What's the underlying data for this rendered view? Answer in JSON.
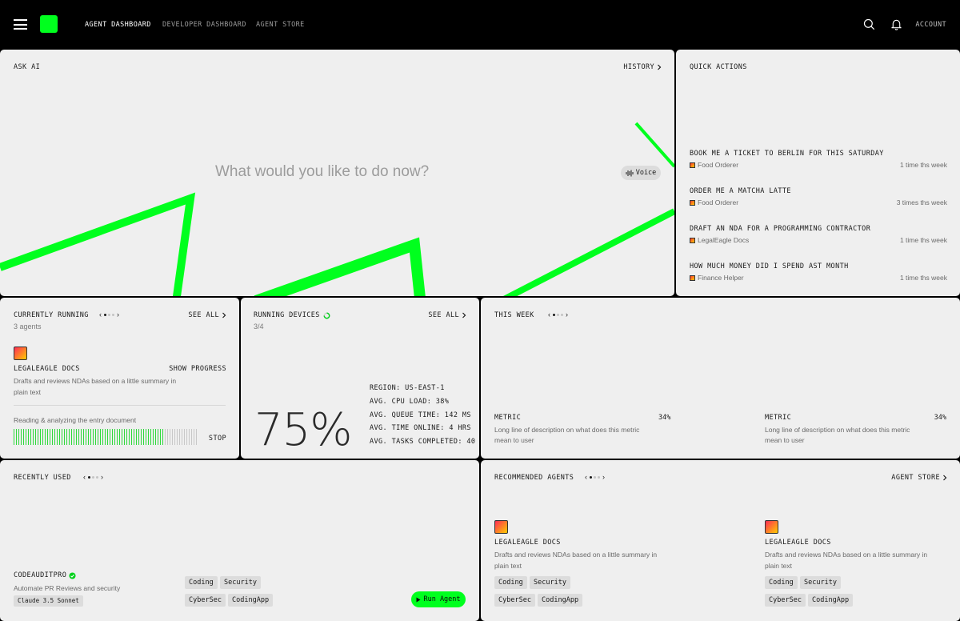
{
  "nav": {
    "items": [
      "AGENT DASHBOARD",
      "DEVELOPER DASHBOARD",
      "AGENT STORE"
    ],
    "account": "ACCOUNT"
  },
  "ask": {
    "title": "ASK AI",
    "history": "HISTORY",
    "placeholder": "What would you like to do now?",
    "voice": "Voice"
  },
  "quick_actions": {
    "title": "QUICK ACTIONS",
    "items": [
      {
        "title": "BOOK ME A TICKET TO BERLIN FOR THIS SATURDAY",
        "agent": "Food Orderer",
        "freq": "1 time ths week"
      },
      {
        "title": "ORDER ME A MATCHA LATTE",
        "agent": "Food Orderer",
        "freq": "3 times ths week"
      },
      {
        "title": "DRAFT AN NDA FOR A PROGRAMMING CONTRACTOR",
        "agent": "LegalEagle Docs",
        "freq": "1 time ths week"
      },
      {
        "title": "HOW MUCH MONEY DID I SPEND AST MONTH",
        "agent": "Finance Helper",
        "freq": "1 time ths week"
      }
    ]
  },
  "running": {
    "title": "CURRENTLY RUNNING",
    "count": "3 agents",
    "see_all": "SEE ALL",
    "agent_name": "LEGALEAGLE DOCS",
    "show_progress": "SHOW PROGRESS",
    "desc": "Drafts and reviews NDAs based on a little summary in plain text",
    "status": "Reading & analyzing the entry document",
    "stop": "STOP",
    "progress": 0.82
  },
  "devices": {
    "title": "RUNNING DEVICES",
    "count": "3/4",
    "see_all": "SEE ALL",
    "percent": "75%",
    "stats": [
      "REGION: US-EAST-1",
      "AVG. CPU LOAD: 38%",
      "AVG. QUEUE TIME: 142 MS",
      "AVG. TIME ONLINE: 4 HRS",
      "AVG. TASKS COMPLETED: 40"
    ]
  },
  "week": {
    "title": "THIS WEEK",
    "metrics": [
      {
        "label": "METRIC",
        "value": "34%",
        "desc": "Long line of description on what does this metric mean to user"
      },
      {
        "label": "METRIC",
        "value": "34%",
        "desc": "Long line of description on what does this metric mean to user"
      }
    ]
  },
  "recent": {
    "title": "RECENTLY USED",
    "agent_name": "CODEAUDITPRO",
    "desc": "Automate PR Reviews and security",
    "model": "Claude 3.5 Sonnet",
    "tags": [
      "Coding",
      "Security",
      "CyberSec",
      "CodingApp"
    ],
    "run": "Run Agent"
  },
  "recommended": {
    "title": "RECOMMENDED AGENTS",
    "store": "AGENT STORE",
    "agents": [
      {
        "name": "LEGALEAGLE DOCS",
        "desc": "Drafts and reviews NDAs based on a little summary in plain text",
        "tags": [
          "Coding",
          "Security",
          "CyberSec",
          "CodingApp"
        ]
      },
      {
        "name": "LEGALEAGLE DOCS",
        "desc": "Drafts and reviews NDAs based on a little summary in plain text",
        "tags": [
          "Coding",
          "Security",
          "CyberSec",
          "CodingApp"
        ]
      }
    ]
  },
  "colors": {
    "accent": "#00ff1e",
    "panel": "#efefef",
    "background": "#000000"
  },
  "icons": [
    "menu-icon",
    "search-icon",
    "bell-icon",
    "chevron-right-icon",
    "waveform-icon",
    "play-icon",
    "verified-icon",
    "spinner-icon"
  ]
}
